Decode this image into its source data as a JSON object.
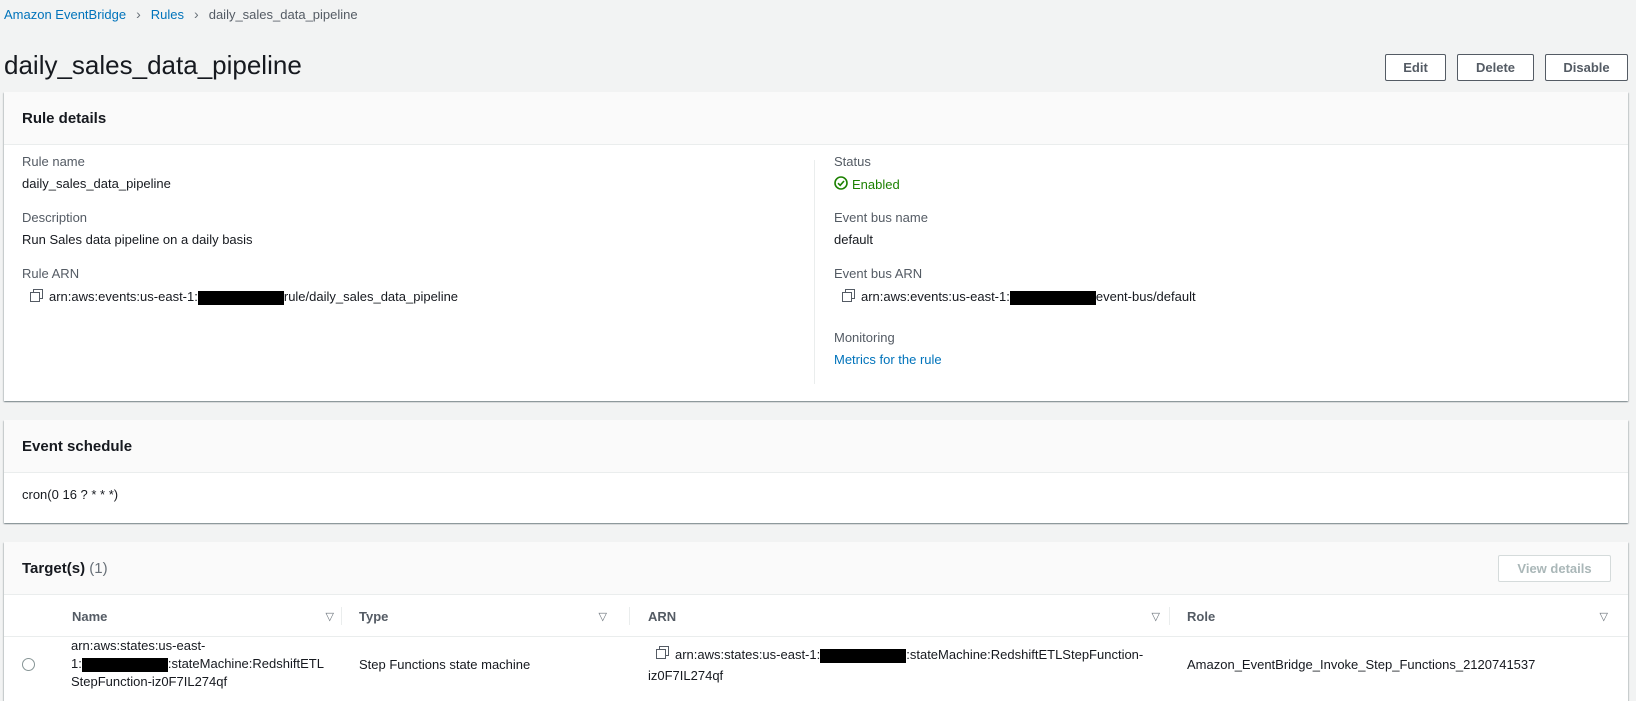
{
  "breadcrumb": {
    "items": [
      "Amazon EventBridge",
      "Rules"
    ],
    "current": "daily_sales_data_pipeline"
  },
  "header": {
    "title": "daily_sales_data_pipeline",
    "edit_label": "Edit",
    "delete_label": "Delete",
    "disable_label": "Disable"
  },
  "rule_details": {
    "title": "Rule details",
    "rule_name_label": "Rule name",
    "rule_name": "daily_sales_data_pipeline",
    "description_label": "Description",
    "description": "Run Sales data pipeline on a daily basis",
    "rule_arn_label": "Rule ARN",
    "rule_arn_prefix": "arn:aws:events:us-east-1:",
    "rule_arn_suffix": "rule/daily_sales_data_pipeline",
    "status_label": "Status",
    "status": "Enabled",
    "event_bus_name_label": "Event bus name",
    "event_bus_name": "default",
    "event_bus_arn_label": "Event bus ARN",
    "event_bus_arn_prefix": "arn:aws:events:us-east-1:",
    "event_bus_arn_suffix": "event-bus/default",
    "monitoring_label": "Monitoring",
    "monitoring_link": "Metrics for the rule"
  },
  "event_schedule": {
    "title": "Event schedule",
    "expression": "cron(0 16 ? * * *)"
  },
  "targets": {
    "title": "Target(s)",
    "count": "(1)",
    "view_details_label": "View details",
    "columns": [
      "Name",
      "Type",
      "ARN",
      "Role"
    ],
    "rows": [
      {
        "name_line1": "arn:aws:states:us-east-",
        "name_line2_prefix": "1:",
        "name_line2_suffix": ":stateMachine:RedshiftETL",
        "name_line3": "StepFunction-iz0F7IL274qf",
        "type": "Step Functions state machine",
        "arn_prefix": "arn:aws:states:us-east-1:",
        "arn_suffix": ":stateMachine:RedshiftETLStepFunction-",
        "arn_line2": "iz0F7IL274qf",
        "role": "Amazon_EventBridge_Invoke_Step_Functions_2120741537"
      }
    ]
  }
}
